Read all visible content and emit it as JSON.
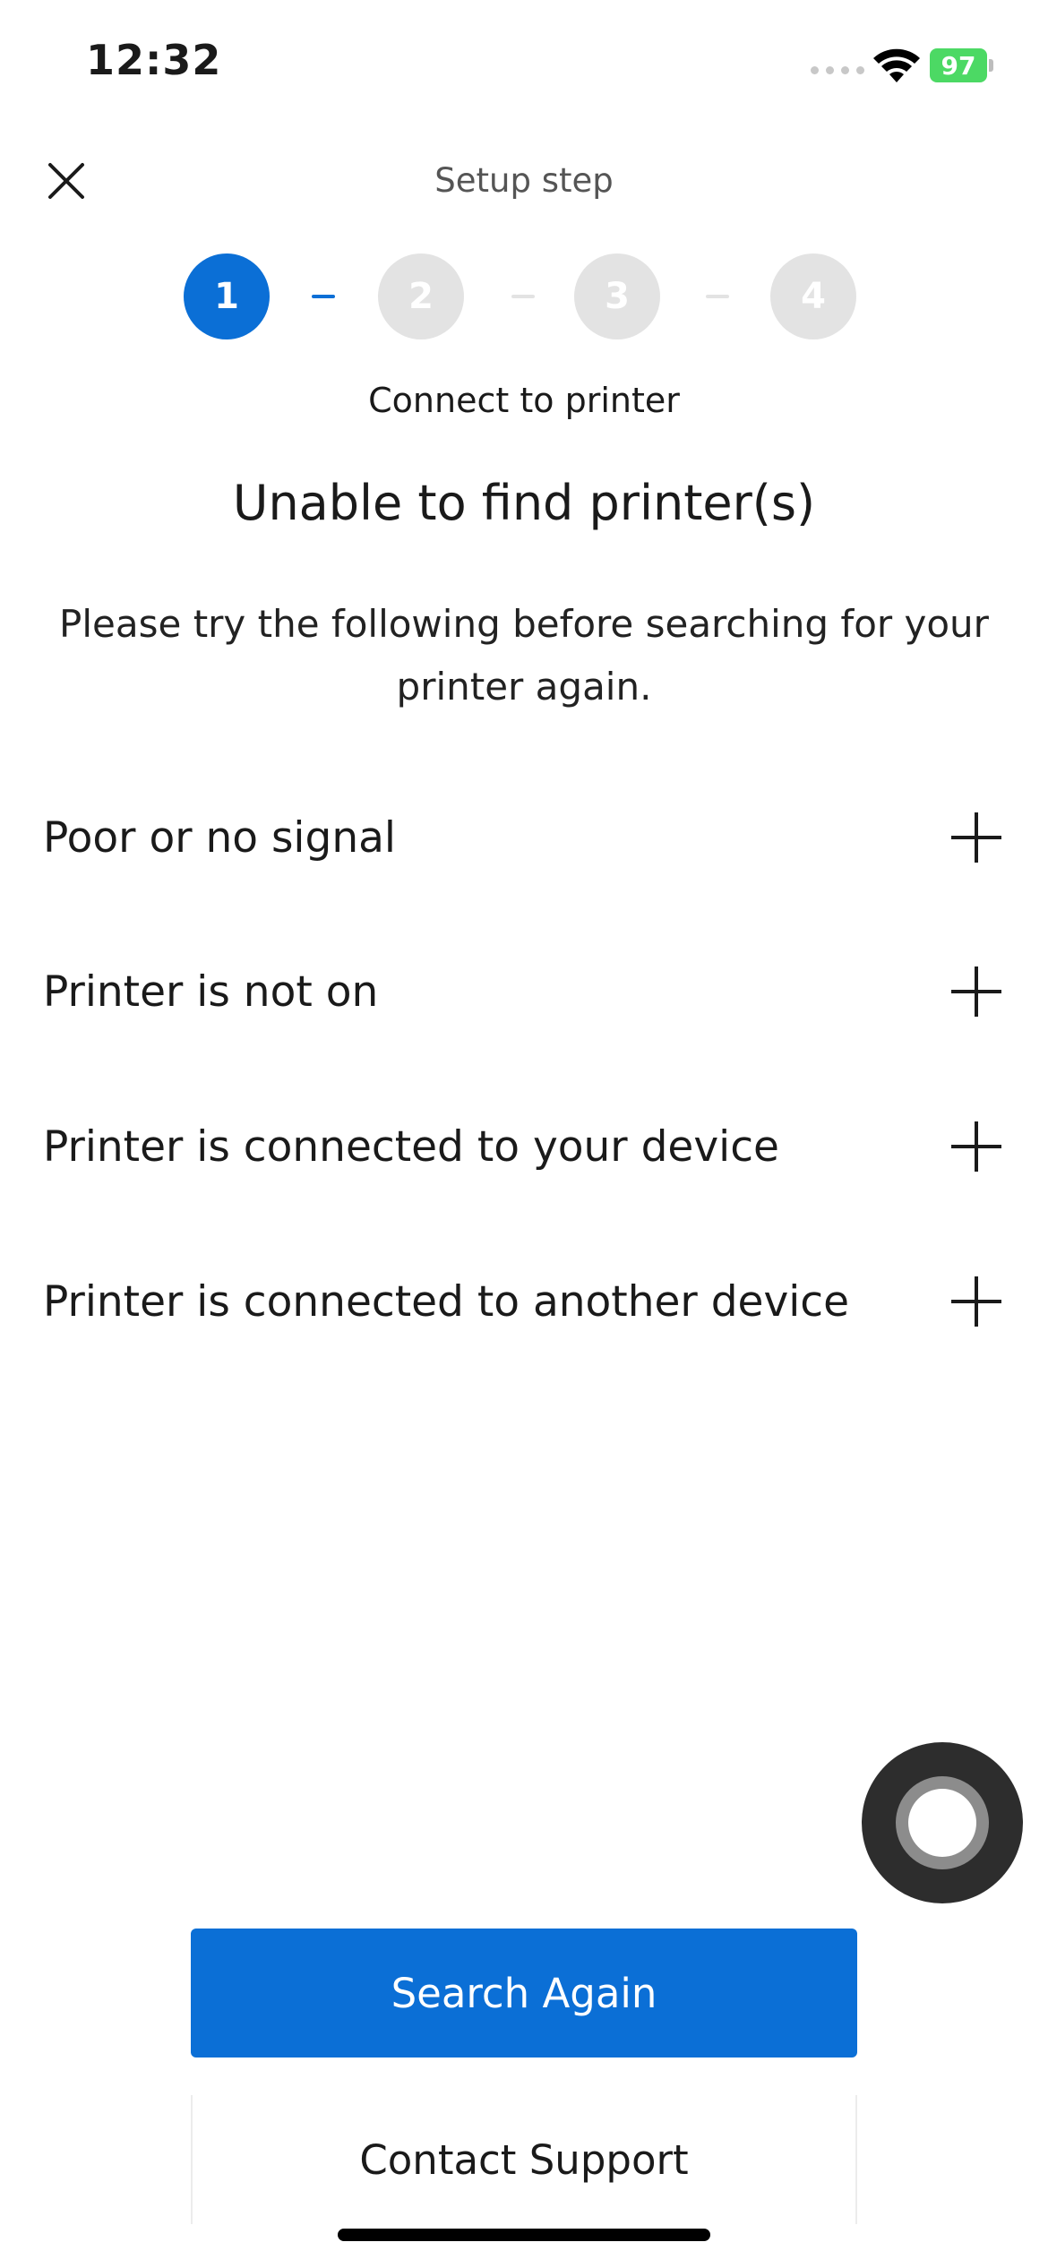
{
  "status_bar": {
    "time": "12:32",
    "battery": "97"
  },
  "header": {
    "title": "Setup step"
  },
  "stepper": {
    "steps": [
      {
        "number": "1",
        "active": true
      },
      {
        "number": "2",
        "active": false
      },
      {
        "number": "3",
        "active": false
      },
      {
        "number": "4",
        "active": false
      }
    ],
    "current_step_label": "Connect to printer"
  },
  "content": {
    "title": "Unable to find printer(s)",
    "intro": "Please try the following before searching for your printer again.",
    "troubleshoot_items": [
      {
        "label": "Poor or no signal"
      },
      {
        "label": "Printer is not on"
      },
      {
        "label": "Printer is connected to your device"
      },
      {
        "label": "Printer is connected to another device"
      }
    ]
  },
  "actions": {
    "primary_label": "Search Again",
    "secondary_label": "Contact Support"
  },
  "colors": {
    "accent": "#0b6fd6",
    "inactive_step": "#e3e3e3",
    "battery": "#4cd964"
  },
  "icons": {
    "close": "close-icon",
    "expand": "plus-icon",
    "wifi": "wifi-icon"
  }
}
